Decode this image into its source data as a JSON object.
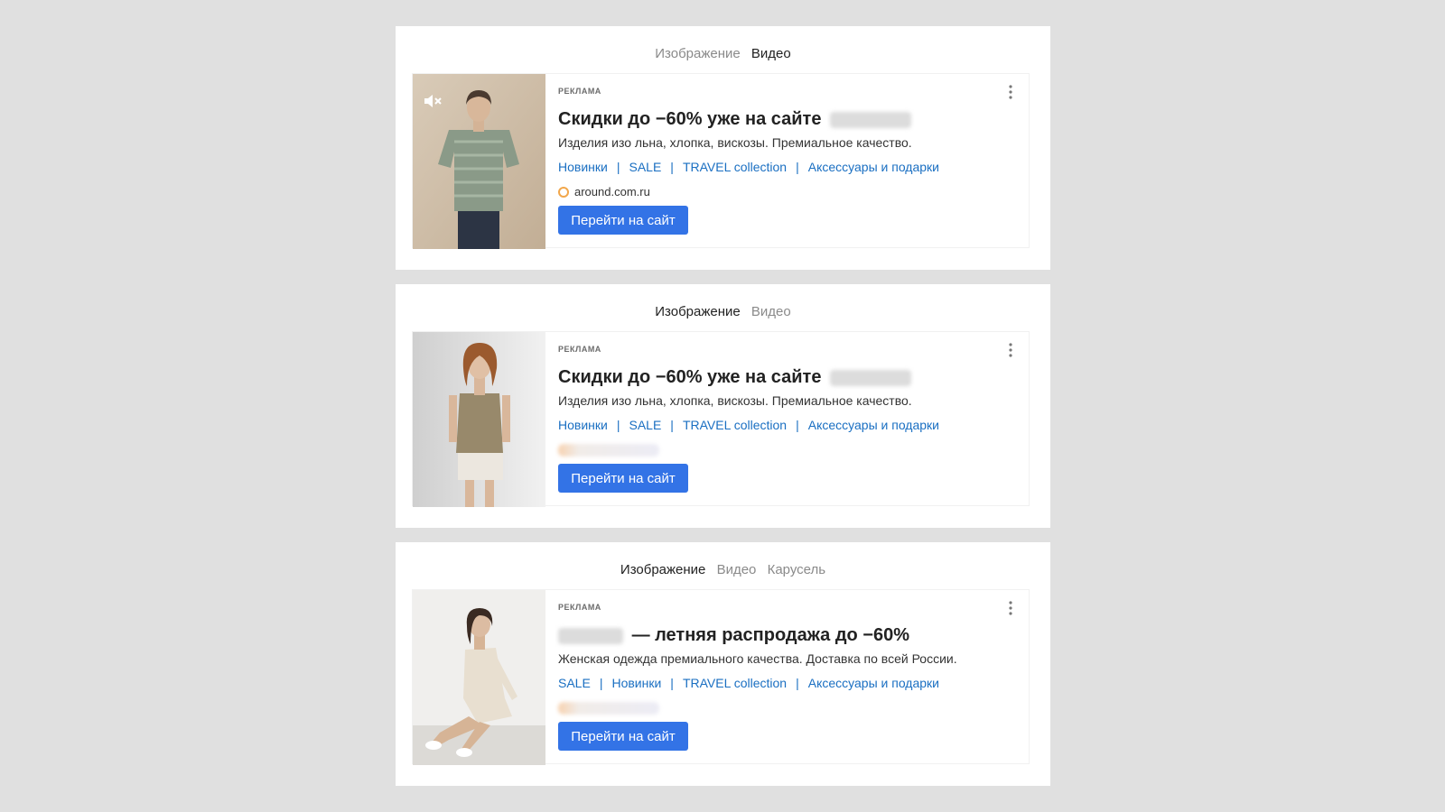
{
  "colors": {
    "page_background": "#e0e0e0",
    "panel_background": "#ffffff",
    "link": "#1a6fc2",
    "cta_background": "#3373e6",
    "tab_active": "#222222",
    "tab_inactive": "#8a8a8a"
  },
  "panels": [
    {
      "tabs": [
        {
          "label": "Изображение",
          "active": false
        },
        {
          "label": "Видео",
          "active": true
        }
      ],
      "ad": {
        "label": "РЕКЛАМА",
        "headline": "Скидки до −60% уже на сайте",
        "headline_has_blurred_brand": true,
        "description": "Изделия изо льна, хлопка, вискозы. Премиальное качество.",
        "sitelinks": [
          "Новинки",
          "SALE",
          "TRAVEL collection",
          "Аксессуары и подарки"
        ],
        "separator": "|",
        "domain": "around.com.ru",
        "cta": "Перейти на сайт",
        "media_icon": "mute-icon",
        "menu_icon": "more-vertical-icon"
      }
    },
    {
      "tabs": [
        {
          "label": "Изображение",
          "active": true
        },
        {
          "label": "Видео",
          "active": false
        }
      ],
      "ad": {
        "label": "РЕКЛАМА",
        "headline": "Скидки до −60% уже на сайте",
        "headline_has_blurred_brand": true,
        "description": "Изделия изо льна, хлопка, вискозы. Премиальное качество.",
        "sitelinks": [
          "Новинки",
          "SALE",
          "TRAVEL collection",
          "Аксессуары и подарки"
        ],
        "separator": "|",
        "domain_blurred": true,
        "cta": "Перейти на сайт",
        "menu_icon": "more-vertical-icon"
      }
    },
    {
      "tabs": [
        {
          "label": "Изображение",
          "active": true
        },
        {
          "label": "Видео",
          "active": false
        },
        {
          "label": "Карусель",
          "active": false
        }
      ],
      "ad": {
        "label": "РЕКЛАМА",
        "headline": "— летняя распродажа до −60%",
        "headline_brand_blurred_prefix": true,
        "description": "Женская одежда премиального качества. Доставка по всей России.",
        "sitelinks": [
          "SALE",
          "Новинки",
          "TRAVEL collection",
          "Аксессуары и подарки"
        ],
        "separator": "|",
        "domain_blurred": true,
        "cta": "Перейти на сайт",
        "menu_icon": "more-vertical-icon"
      }
    }
  ]
}
